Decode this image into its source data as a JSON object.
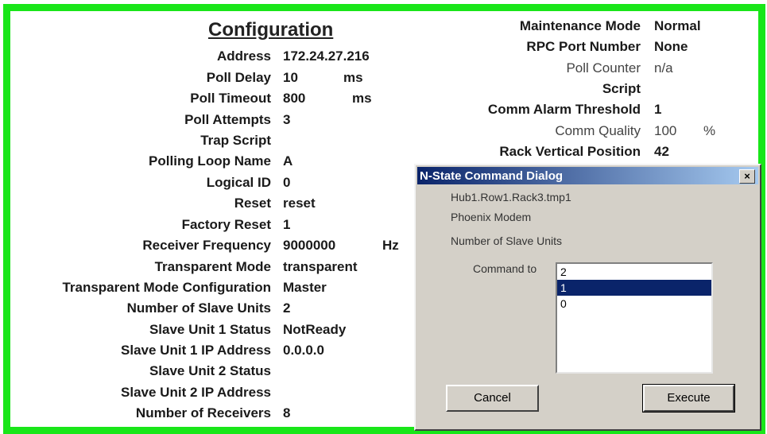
{
  "config": {
    "title": "Configuration",
    "rows": [
      {
        "label": "Address",
        "value": "172.24.27.216",
        "unit": ""
      },
      {
        "label": "Poll Delay",
        "value": "10",
        "unit": "ms"
      },
      {
        "label": "Poll Timeout",
        "value": "800",
        "unit": "ms"
      },
      {
        "label": "Poll Attempts",
        "value": "3",
        "unit": ""
      },
      {
        "label": "Trap Script",
        "value": "",
        "unit": ""
      },
      {
        "label": "Polling Loop Name",
        "value": "A",
        "unit": ""
      },
      {
        "label": "Logical ID",
        "value": "0",
        "unit": ""
      },
      {
        "label": "Reset",
        "value": "reset",
        "unit": ""
      },
      {
        "label": "Factory Reset",
        "value": "1",
        "unit": ""
      },
      {
        "label": "Receiver Frequency",
        "value": "9000000",
        "unit": "Hz"
      },
      {
        "label": "Transparent Mode",
        "value": "transparent",
        "unit": ""
      },
      {
        "label": "Transparent Mode Configuration",
        "value": "Master",
        "unit": ""
      },
      {
        "label": "Number of Slave Units",
        "value": "2",
        "unit": ""
      },
      {
        "label": "Slave Unit 1 Status",
        "value": "NotReady",
        "unit": ""
      },
      {
        "label": "Slave Unit 1 IP Address",
        "value": "0.0.0.0",
        "unit": ""
      },
      {
        "label": "Slave Unit 2 Status",
        "value": "",
        "unit": ""
      },
      {
        "label": "Slave Unit 2 IP Address",
        "value": "",
        "unit": ""
      },
      {
        "label": "Number of Receivers",
        "value": "8",
        "unit": ""
      }
    ]
  },
  "right": {
    "rows": [
      {
        "label": "Maintenance Mode",
        "value": "Normal",
        "unit": ""
      },
      {
        "label": "RPC Port Number",
        "value": "None",
        "unit": ""
      },
      {
        "label": "Poll Counter",
        "value": "n/a",
        "unit": ""
      },
      {
        "label": "Script",
        "value": "",
        "unit": ""
      },
      {
        "label": "Comm Alarm Threshold",
        "value": "1",
        "unit": ""
      },
      {
        "label": "Comm Quality",
        "value": "100",
        "unit": "%"
      },
      {
        "label": "Rack Vertical Position",
        "value": "42",
        "unit": ""
      }
    ]
  },
  "dialog": {
    "title": "N-State Command Dialog",
    "close_label": "×",
    "device_path": "Hub1.Row1.Rack3.tmp1",
    "device_type": "Phoenix Modem",
    "property": "Number of Slave Units",
    "command_label": "Command to",
    "options": [
      "2",
      "1",
      "0"
    ],
    "selected_option": "1",
    "cancel_label": "Cancel",
    "execute_label": "Execute"
  },
  "colors": {
    "frame_border": "#19e619",
    "titlebar_start": "#0a246a",
    "titlebar_end": "#a6caf0",
    "selection": "#0a246a"
  }
}
